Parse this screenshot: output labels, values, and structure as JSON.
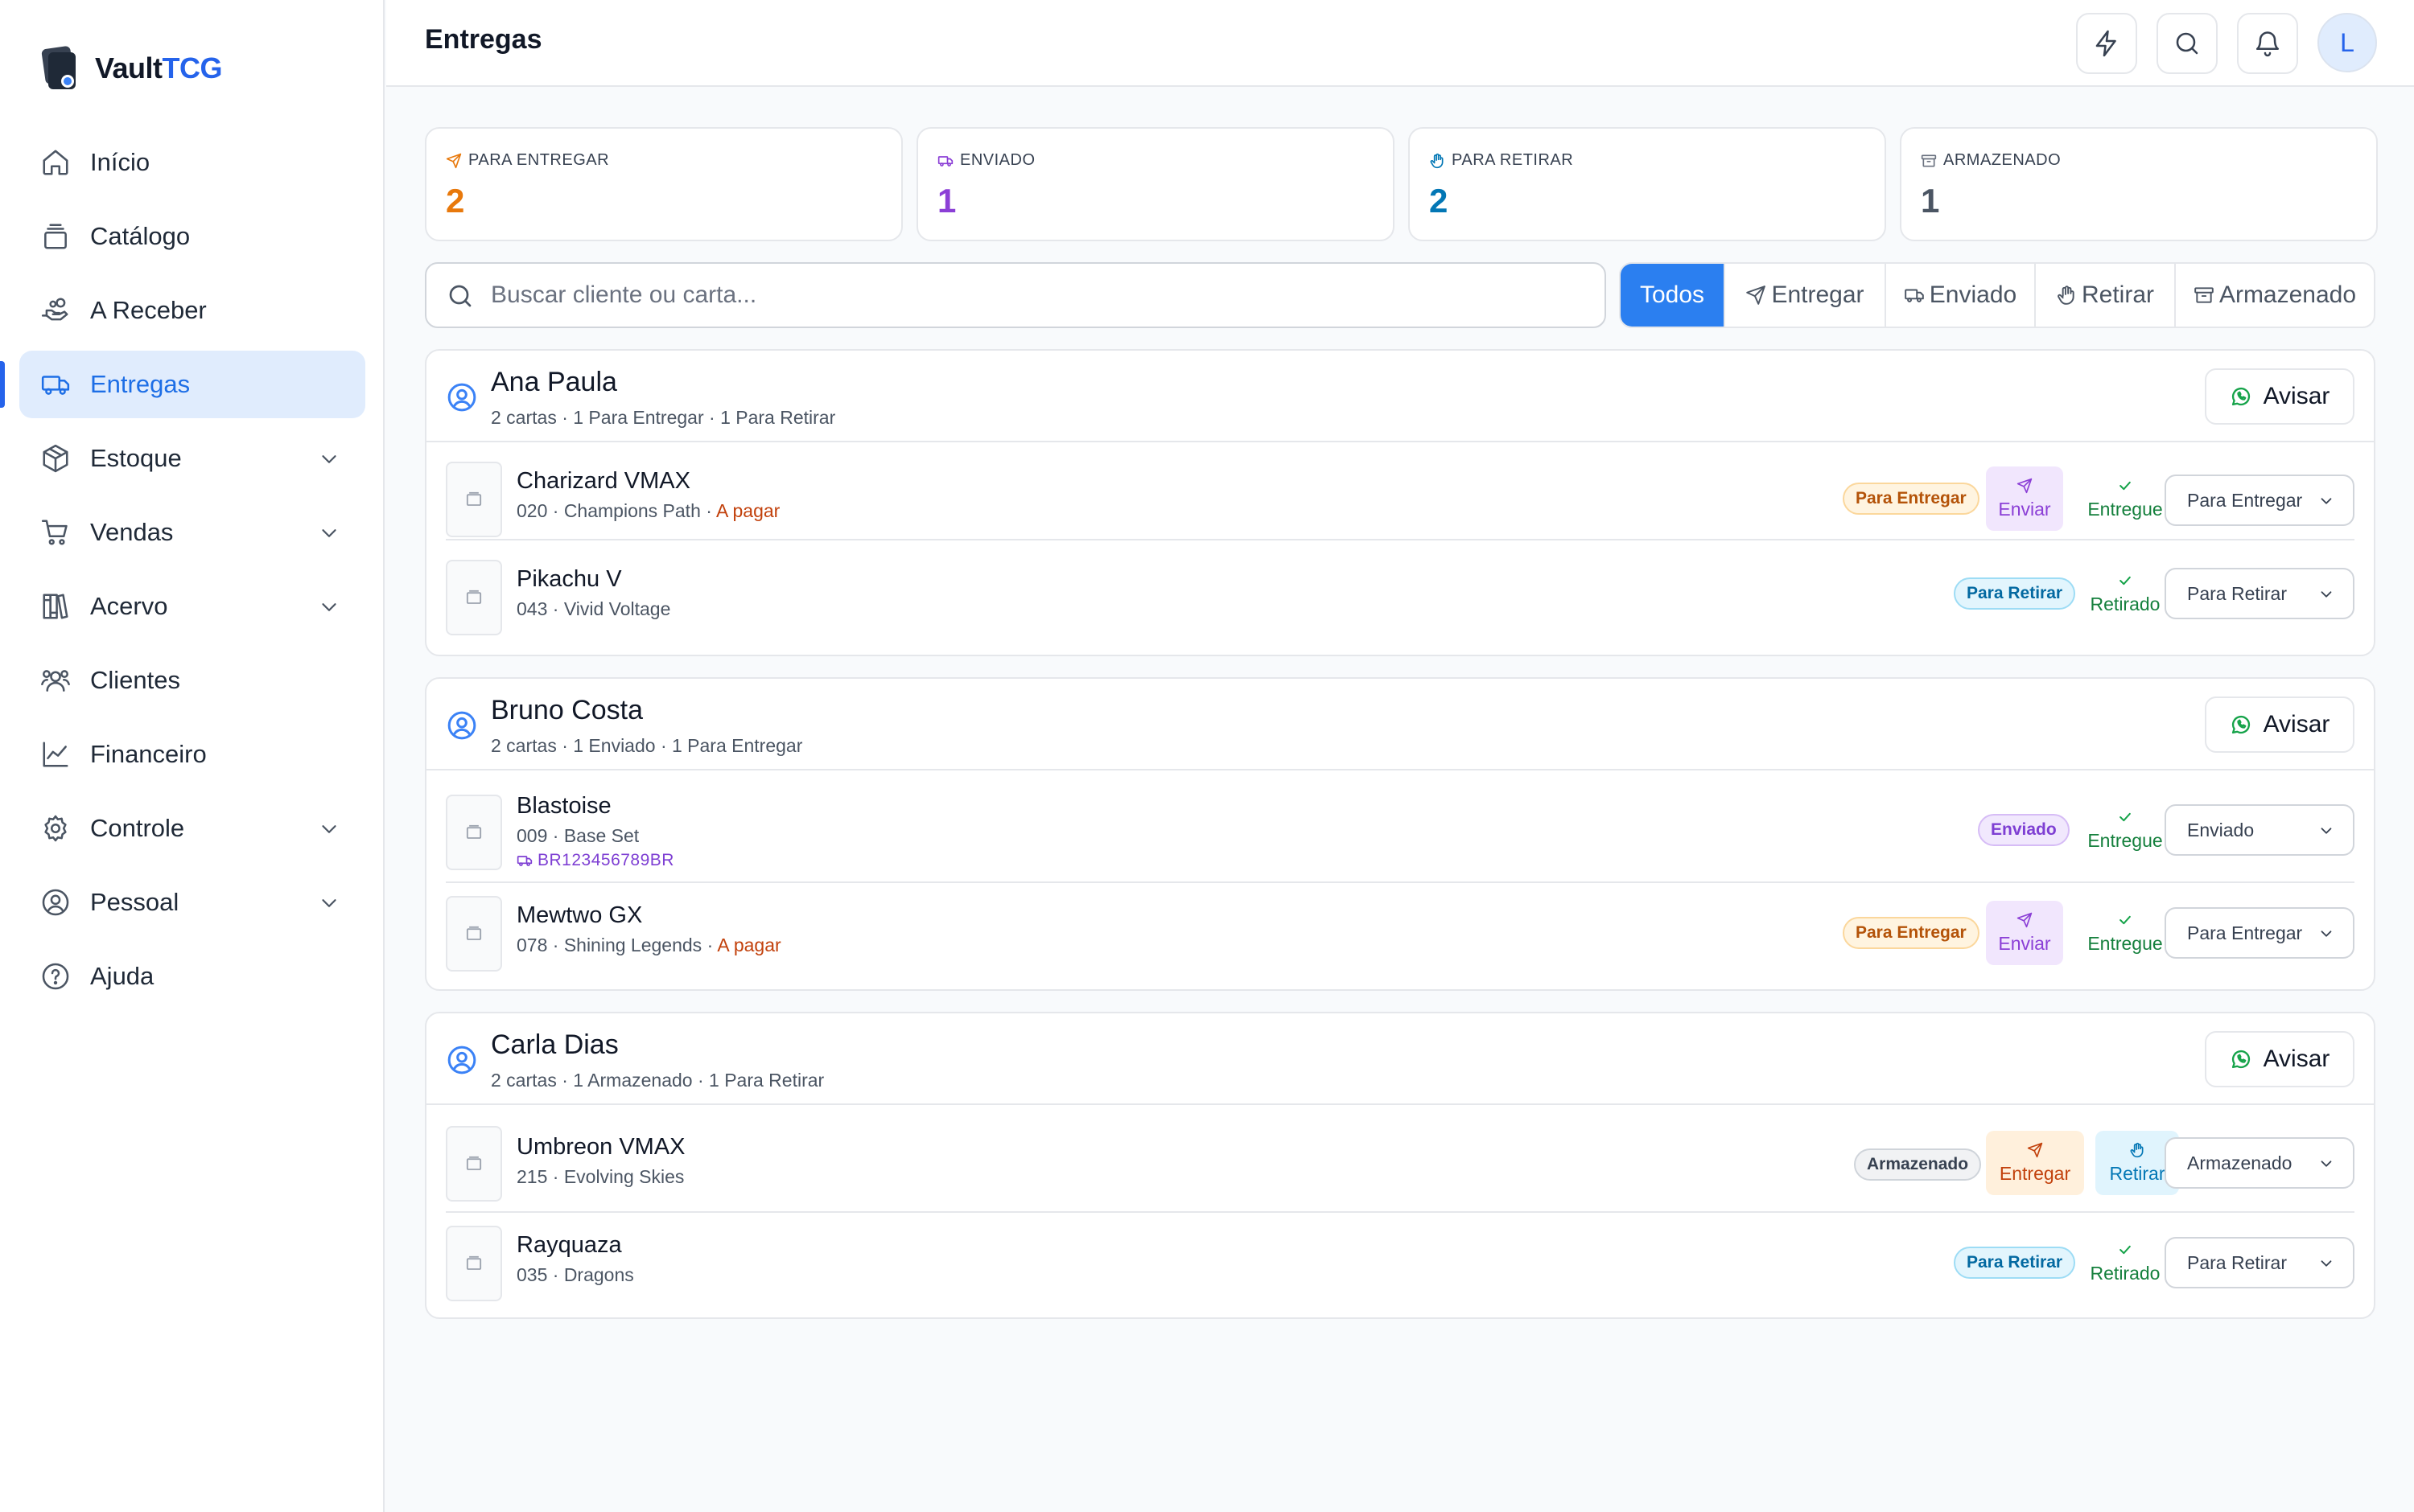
{
  "brand": {
    "name_prefix": "Vault",
    "name_suffix": "TCG"
  },
  "sidebar": {
    "items": [
      {
        "label": "Início",
        "icon": "home-icon",
        "expandable": false,
        "active": false
      },
      {
        "label": "Catálogo",
        "icon": "layers-icon",
        "expandable": false,
        "active": false
      },
      {
        "label": "A Receber",
        "icon": "hand-coins-icon",
        "expandable": false,
        "active": false
      },
      {
        "label": "Entregas",
        "icon": "truck-icon",
        "expandable": false,
        "active": true
      },
      {
        "label": "Estoque",
        "icon": "package-icon",
        "expandable": true,
        "active": false
      },
      {
        "label": "Vendas",
        "icon": "cart-icon",
        "expandable": true,
        "active": false
      },
      {
        "label": "Acervo",
        "icon": "library-icon",
        "expandable": true,
        "active": false
      },
      {
        "label": "Clientes",
        "icon": "users-icon",
        "expandable": false,
        "active": false
      },
      {
        "label": "Financeiro",
        "icon": "chart-line-icon",
        "expandable": false,
        "active": false
      },
      {
        "label": "Controle",
        "icon": "settings-icon",
        "expandable": true,
        "active": false
      },
      {
        "label": "Pessoal",
        "icon": "user-circle-icon",
        "expandable": true,
        "active": false
      },
      {
        "label": "Ajuda",
        "icon": "help-circle-icon",
        "expandable": false,
        "active": false
      }
    ]
  },
  "header": {
    "title": "Entregas",
    "actions": [
      "zap-icon",
      "search-icon",
      "bell-icon"
    ],
    "avatar_initial": "L"
  },
  "stats": [
    {
      "label": "PARA ENTREGAR",
      "value": "2",
      "color": "#e8790c",
      "icon": "send-icon"
    },
    {
      "label": "ENVIADO",
      "value": "1",
      "color": "#8b3fd6",
      "icon": "truck-icon"
    },
    {
      "label": "PARA RETIRAR",
      "value": "2",
      "color": "#0377b5",
      "icon": "hand-icon"
    },
    {
      "label": "ARMAZENADO",
      "value": "1",
      "color": "#4b5563",
      "icon": "archive-icon"
    }
  ],
  "search": {
    "placeholder": "Buscar cliente ou carta...",
    "value": ""
  },
  "filters": [
    {
      "label": "Todos",
      "active": true
    },
    {
      "label": "Entregar",
      "icon": "send-icon"
    },
    {
      "label": "Enviado",
      "icon": "truck-icon"
    },
    {
      "label": "Retirar",
      "icon": "hand-icon"
    },
    {
      "label": "Armazenado",
      "icon": "archive-icon"
    }
  ],
  "groups": [
    {
      "client": "Ana Paula",
      "summary": "2 cartas · 1 Para Entregar · 1 Para Retirar",
      "notify_label": "Avisar",
      "cards": [
        {
          "name": "Charizard VMAX",
          "sub": "020 · Champions Path",
          "payment": "A pagar",
          "badge": "Para Entregar",
          "actions": [
            "Enviar",
            "Entregue"
          ],
          "status": "Para Entregar"
        },
        {
          "name": "Pikachu V",
          "sub": "043 · Vivid Voltage",
          "badge": "Para Retirar",
          "actions": [
            "Retirado"
          ],
          "status": "Para Retirar"
        }
      ]
    },
    {
      "client": "Bruno Costa",
      "summary": "2 cartas · 1 Enviado · 1 Para Entregar",
      "notify_label": "Avisar",
      "cards": [
        {
          "name": "Blastoise",
          "sub": "009 · Base Set",
          "tracking": "BR123456789BR",
          "badge": "Enviado",
          "actions": [
            "Entregue"
          ],
          "status": "Enviado"
        },
        {
          "name": "Mewtwo GX",
          "sub": "078 · Shining Legends",
          "payment": "A pagar",
          "badge": "Para Entregar",
          "actions": [
            "Enviar",
            "Entregue"
          ],
          "status": "Para Entregar"
        }
      ]
    },
    {
      "client": "Carla Dias",
      "summary": "2 cartas · 1 Armazenado · 1 Para Retirar",
      "notify_label": "Avisar",
      "cards": [
        {
          "name": "Umbreon VMAX",
          "sub": "215 · Evolving Skies",
          "badge": "Armazenado",
          "actions": [
            "Entregar",
            "Retirar"
          ],
          "status": "Armazenado"
        },
        {
          "name": "Rayquaza",
          "sub": "035 · Dragons",
          "badge": "Para Retirar",
          "actions": [
            "Retirado"
          ],
          "status": "Para Retirar"
        }
      ]
    }
  ],
  "colors": {
    "accent": "#2b7ff0",
    "sidebar_active_bg": "#e0ecfd",
    "whatsapp": "#16a34a"
  }
}
